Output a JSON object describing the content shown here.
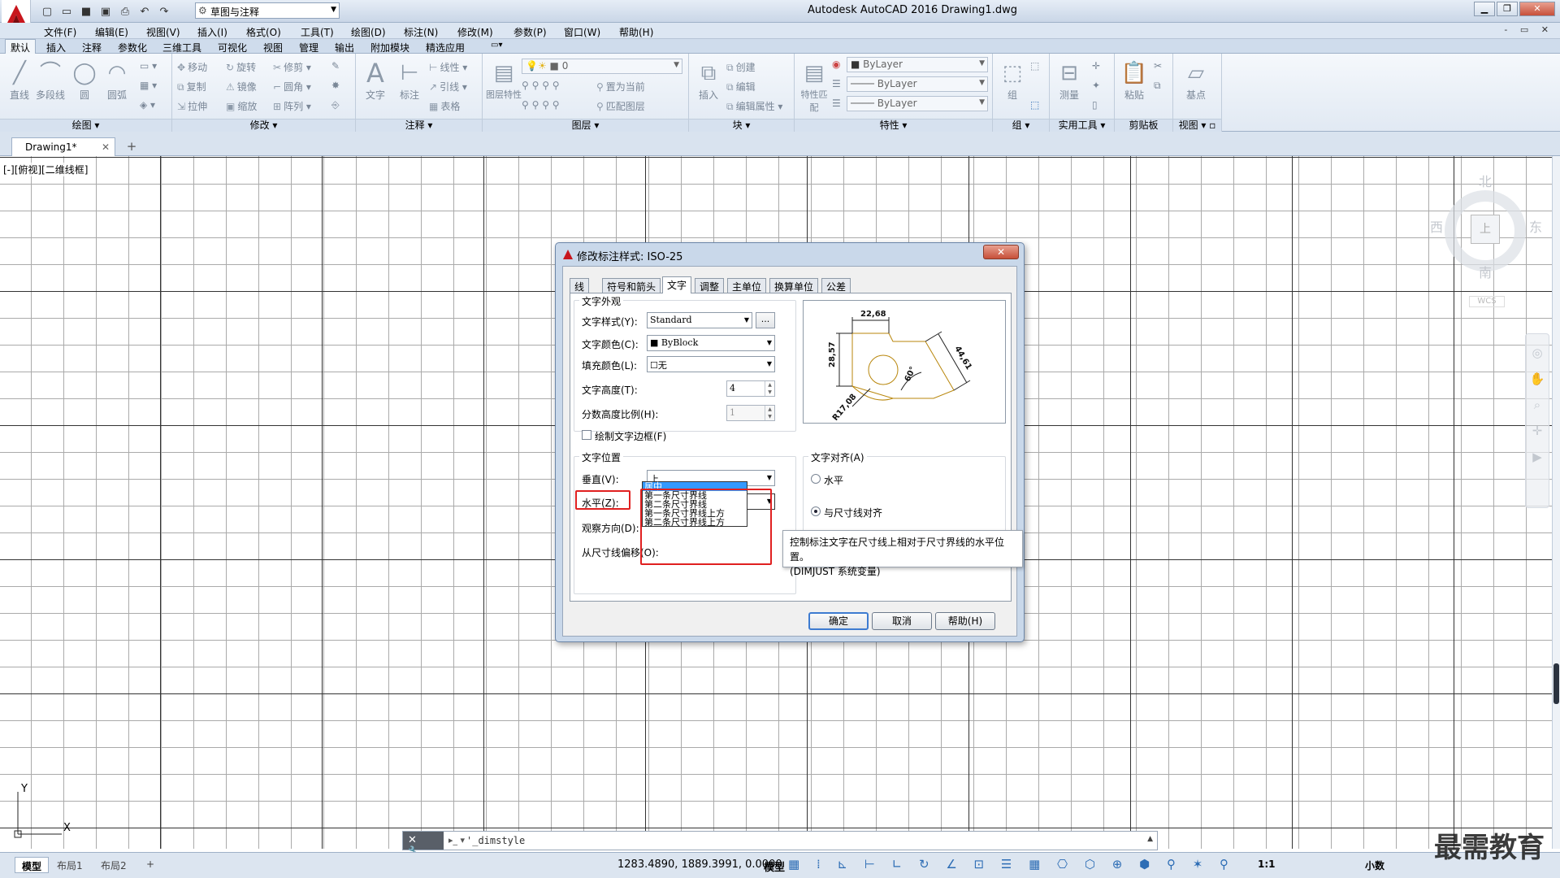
{
  "titlebar": {
    "title": "Autodesk AutoCAD 2016    Drawing1.dwg",
    "workspace": "草图与注释",
    "qat_icons": [
      "new-icon",
      "open-icon",
      "save-icon",
      "save-as-icon",
      "print-icon",
      "undo-icon",
      "redo-icon"
    ]
  },
  "menubar": {
    "items": [
      "文件(F)",
      "编辑(E)",
      "视图(V)",
      "插入(I)",
      "格式(O)",
      "工具(T)",
      "绘图(D)",
      "标注(N)",
      "修改(M)",
      "参数(P)",
      "窗口(W)",
      "帮助(H)"
    ],
    "right": "- ▭ ✕"
  },
  "ribbon_tabs": [
    "默认",
    "插入",
    "注释",
    "参数化",
    "三维工具",
    "可视化",
    "视图",
    "管理",
    "输出",
    "附加模块",
    "精选应用"
  ],
  "ribbon": {
    "panels": {
      "draw": "绘图",
      "modify": "修改",
      "annotate": "注释",
      "layers": "图层",
      "block": "块",
      "properties": "特性",
      "groups": "组",
      "utilities": "实用工具",
      "clipboard": "剪贴板",
      "view": "视图"
    },
    "draw_tools": [
      "直线",
      "多段线",
      "圆",
      "圆弧"
    ],
    "modify_tools": [
      "移动",
      "旋转",
      "修剪",
      "复制",
      "镜像",
      "圆角",
      "拉伸",
      "缩放",
      "阵列"
    ],
    "annotate_tools": {
      "text": "文字",
      "dim": "标注",
      "linear": "线性",
      "leader": "引线",
      "table": "表格"
    },
    "layer_tools": {
      "props": "图层特性",
      "current": "置为当前",
      "match": "匹配图层",
      "layer_value": "0"
    },
    "block_tools": {
      "insert": "插入",
      "create": "创建",
      "edit": "编辑",
      "edit_attr": "编辑属性"
    },
    "properties": {
      "match": "特性匹配",
      "color": "ByLayer",
      "linetype": "ByLayer",
      "lineweight": "ByLayer"
    },
    "groups_tools": {
      "group": "组"
    },
    "utilities_tools": {
      "measure": "测量"
    },
    "clipboard_tools": {
      "paste": "粘贴"
    },
    "view_tools": {
      "base": "基点"
    }
  },
  "doc_tab": {
    "name": "Drawing1*"
  },
  "viewport_label": "[-][俯视][二维线框]",
  "viewcube": {
    "north": "北",
    "south": "南",
    "east": "东",
    "west": "西",
    "face": "上",
    "wcs": "WCS"
  },
  "dialog": {
    "title": "修改标注样式: ISO-25",
    "close": "✕",
    "tabs": [
      "线",
      "符号和箭头",
      "文字",
      "调整",
      "主单位",
      "换算单位",
      "公差"
    ],
    "active_tab": "文字",
    "appearance": {
      "group_title": "文字外观",
      "text_style_label": "文字样式(Y):",
      "text_style_value": "Standard",
      "text_color_label": "文字颜色(C):",
      "text_color_value": "ByBlock",
      "fill_color_label": "填充颜色(L):",
      "fill_color_value": "无",
      "text_height_label": "文字高度(T):",
      "text_height_value": "4",
      "fraction_label": "分数高度比例(H):",
      "fraction_value": "1",
      "frame_label": "绘制文字边框(F)"
    },
    "placement": {
      "group_title": "文字位置",
      "vertical_label": "垂直(V):",
      "vertical_value": "上",
      "horizontal_label": "水平(Z):",
      "horizontal_value": "居中",
      "view_dir_label": "观察方向(D):",
      "offset_label": "从尺寸线偏移(O):"
    },
    "dropdown_options": [
      "居中",
      "第一条尺寸界线",
      "第二条尺寸界线",
      "第一条尺寸界线上方",
      "第二条尺寸界线上方"
    ],
    "alignment": {
      "group_title": "文字对齐(A)",
      "horizontal": "水平",
      "aligned": "与尺寸线对齐"
    },
    "preview": {
      "d1": "22,68",
      "d2": "28,57",
      "d3": "44,61",
      "d4": "60°",
      "d5": "R17,08"
    },
    "buttons": {
      "ok": "确定",
      "cancel": "取消",
      "help": "帮助(H)"
    },
    "tooltip": {
      "line1": "控制标注文字在尺寸线上相对于尺寸界线的水平位置。",
      "line2": "(DIMJUST 系统变量)"
    }
  },
  "cmdline": {
    "text": "'_dimstyle"
  },
  "statusbar": {
    "layouts": [
      "模型",
      "布局1",
      "布局2"
    ],
    "coords": "1283.4890, 1889.3991, 0.0000",
    "model": "模型",
    "scale": "1:1",
    "units": "小数"
  },
  "watermark": "最需教育",
  "colors": {
    "accent": "#3399ff",
    "highlight": "#e02020",
    "title_bg": "#c9d8ea"
  }
}
